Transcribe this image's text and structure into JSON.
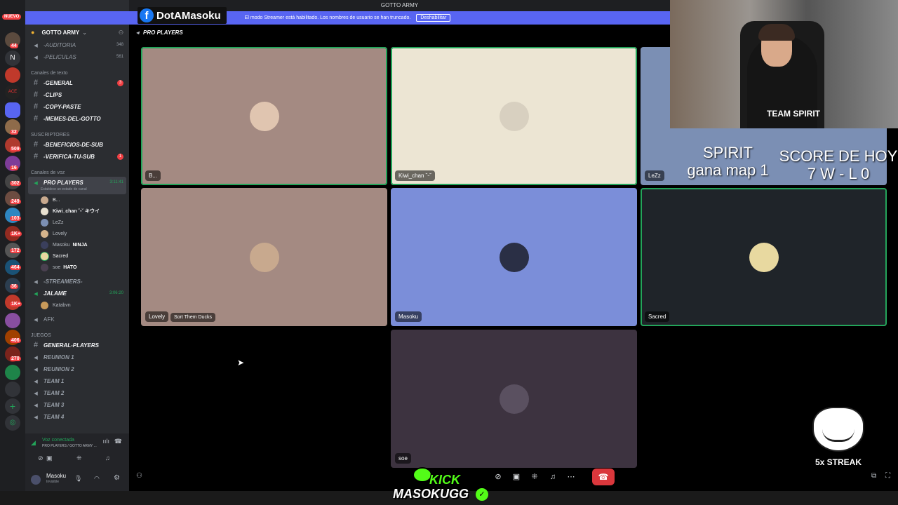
{
  "window_title": "GOTTO ARMY",
  "streamer_notice": "El modo Streamer está habilitado. Los nombres de usuario se han truncado.",
  "streamer_disable": "Deshabilitar",
  "overlay_name": "DotAMasoku",
  "server": {
    "name": "GOTTO ARMY"
  },
  "servers": {
    "new_label": "NUEVO",
    "badges": [
      "44",
      "32",
      "509",
      "16",
      "302",
      "249",
      "103",
      "1K+",
      "172",
      "464",
      "36",
      "1K+",
      "406",
      "270"
    ]
  },
  "top_channels": [
    {
      "name": "-AUDITORIA",
      "count": "348"
    },
    {
      "name": "-PELICULAS",
      "count": "561"
    }
  ],
  "text_category": "Canales de texto",
  "text_channels": [
    {
      "name": "-GENERAL",
      "badge": "3"
    },
    {
      "name": "-CLIPS",
      "badge": ""
    },
    {
      "name": "-COPY-PASTE",
      "badge": ""
    },
    {
      "name": "-MEMES-DEL-GOTTO",
      "badge": ""
    }
  ],
  "sub_category": "SUSCRIPTORES",
  "sub_channels": [
    {
      "name": "-BENEFICIOS-DE-SUB",
      "badge": ""
    },
    {
      "name": "-VERIFICA-TU-SUB",
      "badge": "1"
    }
  ],
  "voice_category": "Canales de voz",
  "active_voice": {
    "name": "PRO PLAYERS",
    "time": "3:11:41",
    "status": "Establece un estado de canal"
  },
  "voice_members": [
    "B...",
    "Kiwi_chan ˘ᵕ˘ キウイ",
    "LeZz",
    "Lovely",
    "Masoku",
    "Sacred",
    "soe"
  ],
  "member_tags": {
    "Masoku": "NINJA",
    "soe": "HATO"
  },
  "streamers": {
    "name": "-STREAMERS-"
  },
  "jalame": {
    "name": "JALAME",
    "time": "3:06:20",
    "member": "Katabvn"
  },
  "afk": "AFK",
  "games_category": "JUEGOS",
  "game_channels": [
    "GENERAL-PLAYERS",
    "REUNION 1",
    "REUNION 2",
    "TEAM 1",
    "TEAM 2",
    "TEAM 3",
    "TEAM 4"
  ],
  "voice_panel": {
    "status": "Voz conectada",
    "channel": "PRO PLAYERS / GOTTO ARMY ..."
  },
  "user": {
    "name": "Masoku",
    "status": "Invisible"
  },
  "channel_header": "PRO PLAYERS",
  "tiles": [
    {
      "name": "B...",
      "bg": "#a48a82",
      "activity": ""
    },
    {
      "name": "Kiwi_chan ˘ᵕ˘",
      "bg": "#ece5d3",
      "activity": ""
    },
    {
      "name": "LeZz",
      "bg": "#7b8fb4",
      "activity": ""
    },
    {
      "name": "Lovely",
      "bg": "#a48a82",
      "activity": "Sort Them Ducks"
    },
    {
      "name": "Masoku",
      "bg": "#7b8ed9",
      "activity": ""
    },
    {
      "name": "Sacred",
      "bg": "#1f2429",
      "activity": ""
    },
    {
      "name": "soe",
      "bg": "#3d3340",
      "activity": ""
    }
  ],
  "overlay_spirit": {
    "line1": "SPIRIT",
    "line2": "gana map 1"
  },
  "overlay_score": {
    "line1": "SCORE DE HOY",
    "line2": "7 W - L 0"
  },
  "webcam_jersey": "TEAM SPIRIT",
  "kick": {
    "line1": "KICK",
    "line2": "MASOKUGG"
  },
  "streak": "5x STREAK",
  "colors": {
    "accent": "#5865f2",
    "speaking": "#23a55a",
    "hangup": "#da373c"
  }
}
